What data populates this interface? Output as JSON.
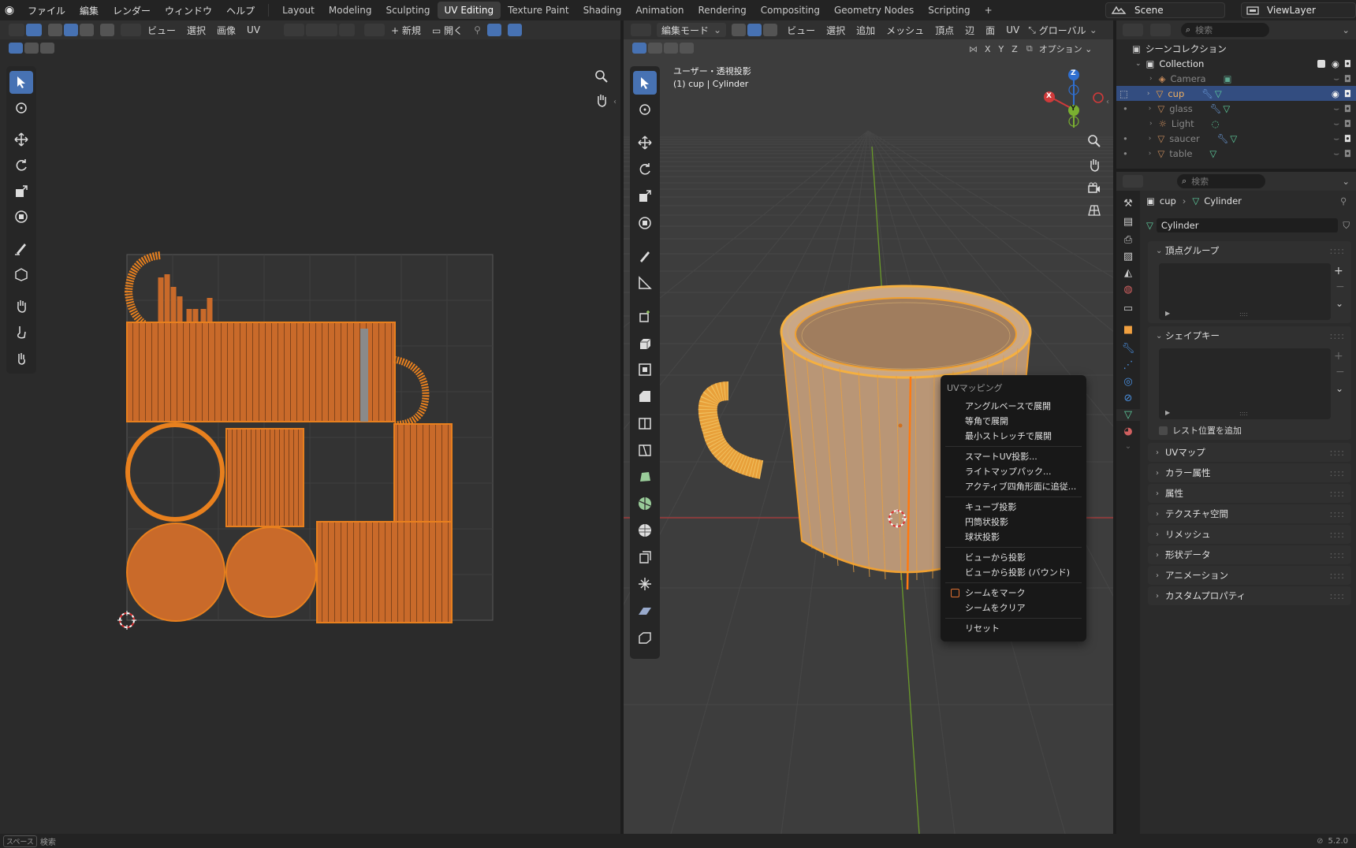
{
  "topbar": {
    "menu": [
      "ファイル",
      "編集",
      "レンダー",
      "ウィンドウ",
      "ヘルプ"
    ],
    "tabs": [
      "Layout",
      "Modeling",
      "Sculpting",
      "UV Editing",
      "Texture Paint",
      "Shading",
      "Animation",
      "Rendering",
      "Compositing",
      "Geometry Nodes",
      "Scripting"
    ],
    "active_tab": "UV Editing",
    "scene": "Scene",
    "view_layer": "ViewLayer"
  },
  "uv_editor": {
    "header": {
      "view": "ビュー",
      "select": "選択",
      "image": "画像",
      "uv": "UV",
      "new": "新規",
      "open": "開く"
    }
  },
  "viewport": {
    "header": {
      "mode": "編集モード",
      "view": "ビュー",
      "select": "選択",
      "add": "追加",
      "mesh": "メッシュ",
      "vertex": "頂点",
      "edge": "辺",
      "face": "面",
      "uv": "UV",
      "orientation": "グローバル",
      "options": "オプション"
    },
    "overlay_title": "ユーザー・透視投影",
    "overlay_object": "(1) cup | Cylinder",
    "axis": {
      "x": "X",
      "y": "Y",
      "z": "Z"
    },
    "mirror_axes": [
      "X",
      "Y",
      "Z"
    ]
  },
  "context_menu": {
    "title": "UVマッピング",
    "groups": [
      [
        "アングルベースで展開",
        "等角で展開",
        "最小ストレッチで展開"
      ],
      [
        "スマートUV投影...",
        "ライトマップパック...",
        "アクティブ四角形面に追従..."
      ],
      [
        "キューブ投影",
        "円筒状投影",
        "球状投影"
      ],
      [
        "ビューから投影",
        "ビューから投影 (バウンド)"
      ],
      [
        "シームをマーク",
        "シームをクリア"
      ],
      [
        "リセット"
      ]
    ]
  },
  "outliner": {
    "search_placeholder": "検索",
    "root": "シーンコレクション",
    "collection": "Collection",
    "items": [
      "Camera",
      "cup",
      "glass",
      "Light",
      "saucer",
      "table"
    ],
    "selected": "cup"
  },
  "properties": {
    "search_placeholder": "検索",
    "breadcrumb": {
      "object": "cup",
      "data": "Cylinder"
    },
    "mesh_name": "Cylinder",
    "vertex_groups": "頂点グループ",
    "shape_keys": "シェイプキー",
    "rest_position": "レスト位置を追加",
    "panels": [
      "UVマップ",
      "カラー属性",
      "属性",
      "テクスチャ空間",
      "リメッシュ",
      "形状データ",
      "アニメーション",
      "カスタムプロパティ"
    ]
  },
  "statusbar": {
    "key": "スペース",
    "action": "検索",
    "version": "5.2.0"
  },
  "colors": {
    "accent": "#4772b3",
    "uv_fill": "#c96a2a",
    "uv_edge": "#e8801e",
    "select_orange": "#ffa030",
    "menu_bg": "#181818"
  }
}
